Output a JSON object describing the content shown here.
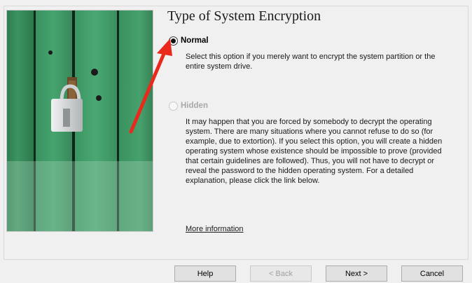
{
  "title": "Type of System Encryption",
  "options": {
    "normal": {
      "label": "Normal",
      "selected": true,
      "description": [
        "Select this option if you merely want to encrypt the system partition or the",
        "entire system drive."
      ]
    },
    "hidden": {
      "label": "Hidden",
      "selected": false,
      "enabled": false,
      "description": [
        "It may happen that you are forced by somebody to decrypt the operating",
        "system. There are many situations where you cannot refuse to do so (for",
        "example, due to extortion). If you select this option, you will create a hidden",
        "operating system whose existence should be impossible to prove (provided",
        "that certain guidelines are followed). Thus, you will not have to decrypt or",
        "reveal the password to the hidden operating system. For a detailed",
        "explanation, please click the link below."
      ]
    }
  },
  "more_info_link": "More information",
  "buttons": {
    "help": "Help",
    "back": "< Back",
    "next": "Next >",
    "cancel": "Cancel"
  },
  "colors": {
    "annotation_arrow": "#e8291c",
    "plank_green": "#3f9a63",
    "plank_dark": "#1f5a3a"
  },
  "icons": {
    "padlock": "padlock-image",
    "arrow": "red-annotation-arrow"
  }
}
